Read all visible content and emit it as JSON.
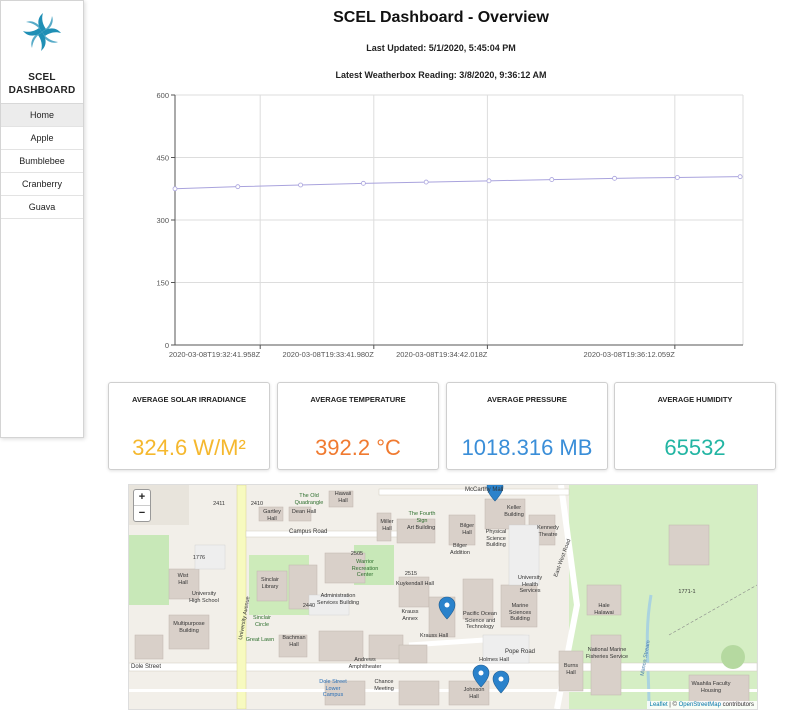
{
  "sidebar": {
    "brand_line1": "SCEL",
    "brand_line2": "DASHBOARD",
    "items": [
      {
        "label": "Home"
      },
      {
        "label": "Apple"
      },
      {
        "label": "Bumblebee"
      },
      {
        "label": "Cranberry"
      },
      {
        "label": "Guava"
      }
    ]
  },
  "header": {
    "title": "SCEL Dashboard - Overview",
    "last_updated": "Last Updated: 5/1/2020, 5:45:04 PM",
    "latest_reading": "Latest Weatherbox Reading: 3/8/2020, 9:36:12 AM"
  },
  "chart_data": {
    "type": "line",
    "title": "",
    "xlabel": "",
    "ylabel": "",
    "ylim": [
      0,
      600
    ],
    "yticks": [
      "0",
      "150",
      "300",
      "450",
      "600"
    ],
    "xticks": [
      "2020-03-08T19:32:41.958Z",
      "2020-03-08T19:33:41.980Z",
      "2020-03-08T19:34:42.018Z",
      "2020-03-08T19:36:12.059Z"
    ],
    "grid": true,
    "colors": {
      "line": "#a9a3dd",
      "grid": "#dddddd",
      "axis": "#555555"
    },
    "series": [
      {
        "values": [
          375,
          380,
          384,
          388,
          391,
          394,
          397,
          400,
          402,
          404
        ]
      }
    ]
  },
  "cards": [
    {
      "label": "AVERAGE SOLAR IRRADIANCE",
      "value": "324.6 W/M²",
      "color": "#f5b82e"
    },
    {
      "label": "AVERAGE TEMPERATURE",
      "value": "392.2 °C",
      "color": "#f07a30"
    },
    {
      "label": "AVERAGE PRESSURE",
      "value": "1018.316 MB",
      "color": "#3a8ed8"
    },
    {
      "label": "AVERAGE HUMIDITY",
      "value": "65532",
      "color": "#22b5a3"
    }
  ],
  "map": {
    "zoom_in": "+",
    "zoom_out": "−",
    "attribution_leaflet": "Leaflet",
    "attribution_sep": " | © ",
    "attribution_osm": "OpenStreetMap",
    "attribution_rest": " contributors",
    "labels": {
      "campus_road": "Campus Road",
      "dole_street": "Dole Street",
      "pope_road": "Pope Road",
      "east_west_road": "East-West Road",
      "university_avenue": "University Avenue",
      "mccarthy_mall": "McCarthy Mall",
      "art_building": "Art Building",
      "bilger_hall": "Bilger Hall",
      "keller_building": "Keller Building",
      "kennedy_theatre": "Kennedy Theatre",
      "kuykendall_hall": "Kuykendall Hall",
      "bachman_hall": "Bachman Hall",
      "sinclair_library": "Sinclair Library",
      "hale_halawai": "Hale Halawai",
      "holmes_hall": "Holmes Hall",
      "burns_hall": "Burns Hall",
      "admin_services": "Administration Services Building",
      "warrior_rec": "Warrior Recreation Center",
      "multipurpose": "Multipurpose Building",
      "uh_high_school": "University High School",
      "physical_science": "Physical Science Building",
      "marine_science": "Marine Sciences Building",
      "pacific_ocean_sci": "Pacific Ocean Science and Technology",
      "andrews_amph": "Andrews Amphitheater",
      "hawaii_hall": "Hawaii Hall",
      "crawford_hall": "Crawford Hall",
      "krauss_hall": "Krauss Hall",
      "krauss_annex": "Krauss Annex",
      "uh_health": "University Health Services",
      "national_marine": "National Marine Fisheries Service",
      "johnson_hall": "Johnson Hall",
      "waahila": "Waahila Faculty Housing",
      "wist_hall": "Wist Hall",
      "gartley_hall": "Gartley Hall",
      "dean_hall": "Dean Hall",
      "miller_hall": "Miller Hall",
      "great_lawn": "Great Lawn",
      "fourth_sign": "The Fourth Sign",
      "old_quad": "The Old Quadrangle",
      "sinclair_circle": "Sinclair Circle",
      "manoa_stream": "Manoa Stream",
      "bilger_addition": "Bilger Addition",
      "chance_meeting": "Chance Meeting",
      "dole_lower_campus": "Dole Street Lower Campus",
      "n2576": "2576",
      "n2505": "2505",
      "n2515": "2515",
      "n2532": "2532",
      "n2525": "2525",
      "n2440": "2440",
      "n1776": "1776",
      "n2410": "2410",
      "n2411": "2411",
      "n1810": "1810",
      "n1771": "1771-1"
    }
  }
}
